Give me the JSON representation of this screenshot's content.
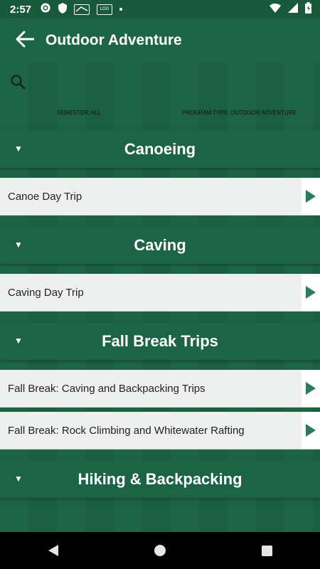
{
  "status": {
    "time": "2:57",
    "icons": [
      "gear-icon",
      "shield-icon",
      "app-logo-icon",
      "calendar-icon"
    ],
    "mini_logo_text": "LOG",
    "right_icons": [
      "wifi-icon",
      "signal-icon",
      "battery-icon"
    ]
  },
  "appbar": {
    "title": "Outdoor Adventure"
  },
  "filters": {
    "semester": "SEMESTER: ALL",
    "program_type": "PROGRAM TYPE: OUTDOOR ADVENTURE"
  },
  "sections": [
    {
      "title": "Canoeing",
      "items": [
        {
          "label": "Canoe Day Trip"
        }
      ]
    },
    {
      "title": "Caving",
      "items": [
        {
          "label": "Caving Day Trip"
        }
      ]
    },
    {
      "title": "Fall Break Trips",
      "items": [
        {
          "label": "Fall Break: Caving and Backpacking Trips"
        },
        {
          "label": "Fall Break: Rock Climbing and Whitewater Rafting"
        }
      ]
    },
    {
      "title": "Hiking & Backpacking",
      "items": []
    }
  ],
  "caret_symbol": "▼",
  "colors": {
    "primary": "#1e6547",
    "accent": "#2c7a5a"
  }
}
